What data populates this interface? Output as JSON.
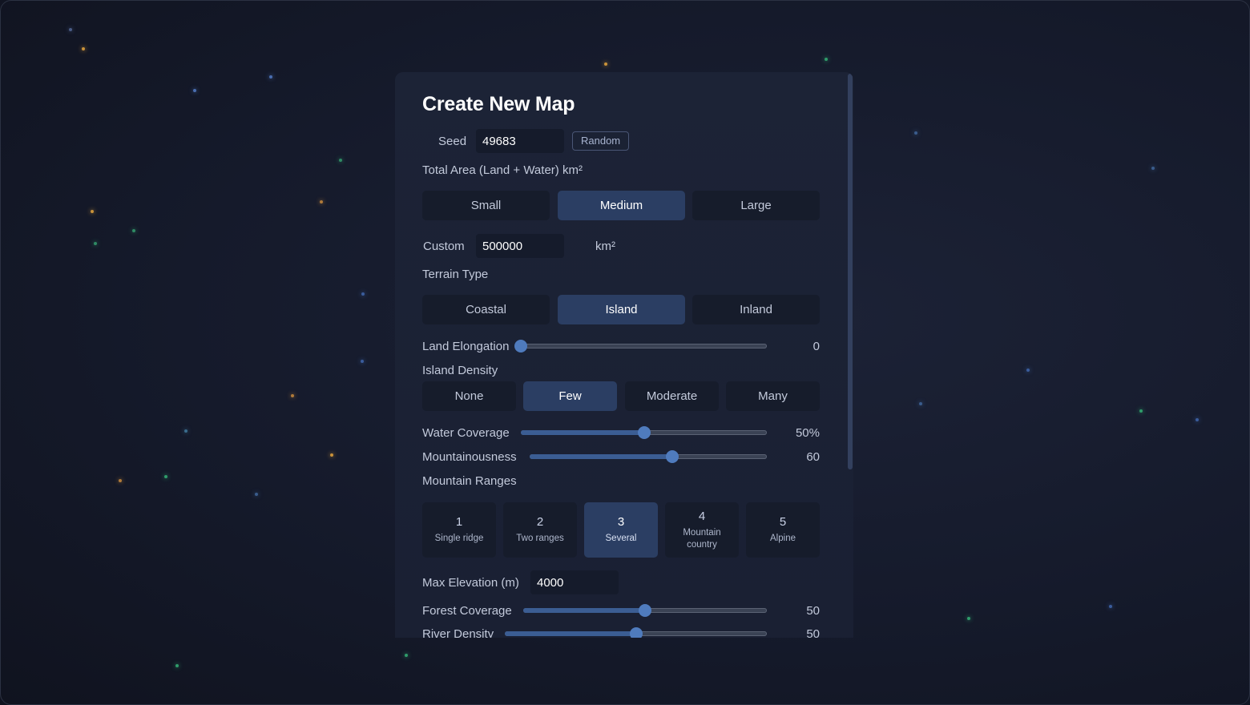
{
  "form": {
    "title": "Create New Map",
    "seed": {
      "label": "Seed",
      "value": "49683",
      "random_label": "Random"
    },
    "area": {
      "label": "Total Area (Land + Water) km²",
      "options": [
        "Small",
        "Medium",
        "Large"
      ],
      "selected": "Medium",
      "custom_label": "Custom",
      "custom_value": "500000",
      "unit": "km²"
    },
    "terrain": {
      "label": "Terrain Type",
      "options": [
        "Coastal",
        "Island",
        "Inland"
      ],
      "selected": "Island"
    },
    "land_elongation": {
      "label": "Land Elongation",
      "value": 0,
      "display": "0",
      "min": 0,
      "max": 100
    },
    "island_density": {
      "label": "Island Density",
      "options": [
        "None",
        "Few",
        "Moderate",
        "Many"
      ],
      "selected": "Few"
    },
    "water_coverage": {
      "label": "Water Coverage",
      "value": 50,
      "display": "50%",
      "min": 0,
      "max": 100
    },
    "mountainousness": {
      "label": "Mountainousness",
      "value": 60,
      "display": "60",
      "min": 0,
      "max": 100
    },
    "mountain_ranges": {
      "label": "Mountain Ranges",
      "options": [
        {
          "num": "1",
          "desc": "Single ridge"
        },
        {
          "num": "2",
          "desc": "Two ranges"
        },
        {
          "num": "3",
          "desc": "Several"
        },
        {
          "num": "4",
          "desc": "Mountain country"
        },
        {
          "num": "5",
          "desc": "Alpine"
        }
      ],
      "selected": "3"
    },
    "max_elevation": {
      "label": "Max Elevation (m)",
      "value": "4000"
    },
    "forest_coverage": {
      "label": "Forest Coverage",
      "value": 50,
      "display": "50",
      "min": 0,
      "max": 100
    },
    "river_density": {
      "label": "River Density",
      "value": 50,
      "display": "50",
      "min": 0,
      "max": 100
    }
  },
  "colors": {
    "accent": "#4f7bbd",
    "active_segment": "#2b3e63",
    "panel": "#1a2033",
    "background": "#151a2b"
  }
}
